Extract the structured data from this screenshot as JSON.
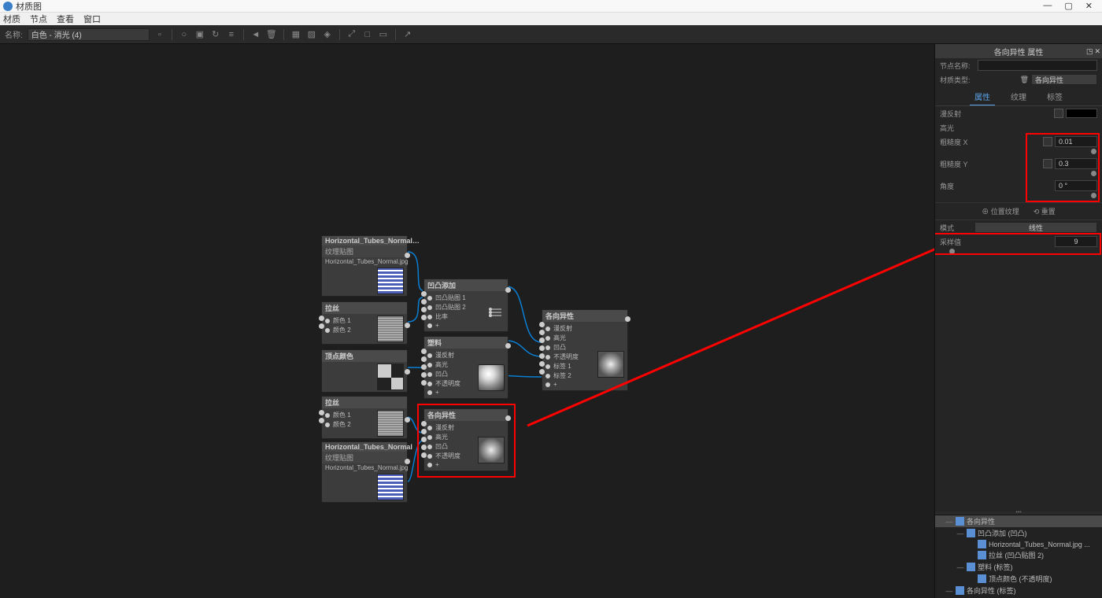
{
  "window_title": "材质图",
  "menubar": [
    "材质",
    "节点",
    "查看",
    "窗口"
  ],
  "toolbar": {
    "name_label": "名称:",
    "name_value": "白色 - 消光 (4)"
  },
  "panel": {
    "title": "各向异性 属性",
    "node_name_label": "节点名称:",
    "node_name_value": "",
    "material_type_label": "材质类型:",
    "material_type_value": "各向异性",
    "tabs": [
      "属性",
      "纹理",
      "标签"
    ],
    "diffuse_label": "漫反射",
    "specular_label": "高光",
    "roughness_x_label": "粗糙度 X",
    "roughness_x_value": "0.01",
    "roughness_y_label": "粗糙度 Y",
    "roughness_y_value": "0.3",
    "angle_label": "角度",
    "angle_value": "0 °",
    "tex_pos": "位置纹理",
    "tex_reset": "重置",
    "mode_label": "模式",
    "mode_value": "线性",
    "sample_label": "采样值",
    "sample_value": "9"
  },
  "tree": {
    "items": [
      {
        "indent": 0,
        "toggle": "—",
        "label": "各向异性"
      },
      {
        "indent": 1,
        "toggle": "—",
        "label": "凹凸添加 (凹凸)"
      },
      {
        "indent": 2,
        "toggle": "",
        "label": "Horizontal_Tubes_Normal.jpg ..."
      },
      {
        "indent": 2,
        "toggle": "",
        "label": "拉丝 (凹凸贴图 2)"
      },
      {
        "indent": 1,
        "toggle": "—",
        "label": "塑料 (标签)"
      },
      {
        "indent": 2,
        "toggle": "",
        "label": "顶点颜色 (不透明度)"
      },
      {
        "indent": 0,
        "toggle": "—",
        "label": "各向异性 (标签)"
      }
    ]
  },
  "nodes": {
    "tex1": {
      "title": "Horizontal_Tubes_Normal…",
      "sub": "纹理贴图",
      "file": "Horizontal_Tubes_Normal.jpg"
    },
    "wire1": {
      "title": "拉丝",
      "in1": "颜色 1",
      "in2": "颜色 2"
    },
    "vcolor": {
      "title": "顶点颜色"
    },
    "wire2": {
      "title": "拉丝",
      "in1": "颜色 1",
      "in2": "颜色 2"
    },
    "tex2": {
      "title": "Horizontal_Tubes_Normal",
      "sub": "纹理贴图",
      "file": "Horizontal_Tubes_Normal.jpg"
    },
    "bump": {
      "title": "凹凸添加",
      "in1": "凹凸贴图 1",
      "in2": "凹凸贴图 2",
      "in3": "比率",
      "plus": "+"
    },
    "plastic": {
      "title": "塑料",
      "in1": "漫反射",
      "in2": "高光",
      "in3": "凹凸",
      "in4": "不透明度",
      "plus": "+"
    },
    "aniso2": {
      "title": "各向异性",
      "in1": "漫反射",
      "in2": "高光",
      "in3": "凹凸",
      "in4": "不透明度",
      "plus": "+"
    },
    "aniso1": {
      "title": "各向异性",
      "in1": "漫反射",
      "in2": "高光",
      "in3": "凹凸",
      "in4": "不透明度",
      "in5": "标签 1",
      "in6": "标签 2",
      "plus": "+"
    }
  }
}
